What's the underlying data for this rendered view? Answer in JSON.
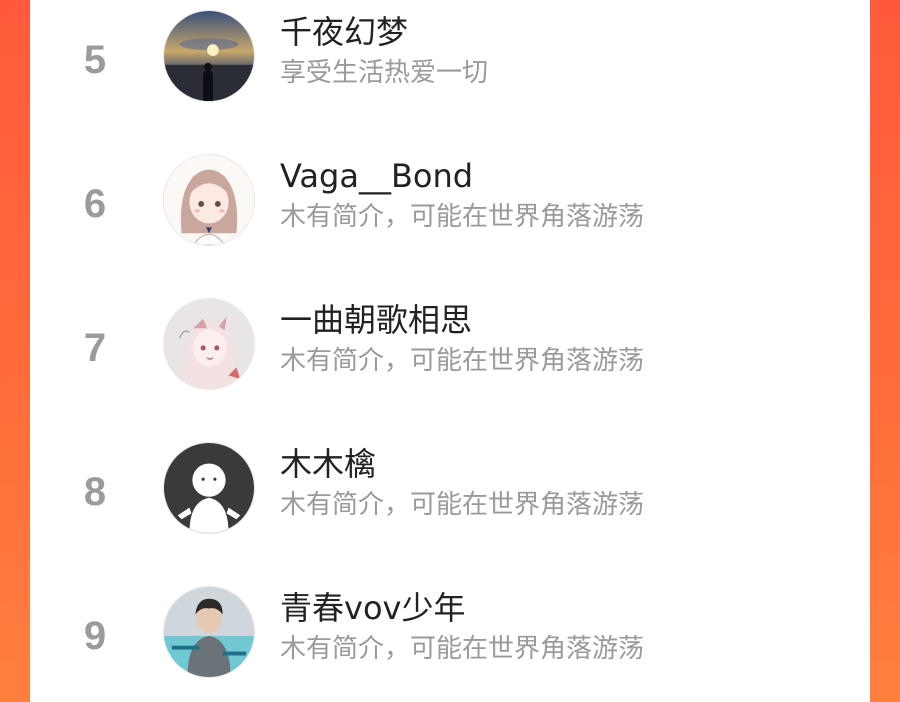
{
  "colors": {
    "background_gradient_top": "#ff5a3c",
    "background_gradient_bottom": "#ff7f3f",
    "card": "#ffffff",
    "rank": "#9b9b9b",
    "name": "#222222",
    "bio": "#9a9a9a"
  },
  "ranking": [
    {
      "rank": "5",
      "name": "千夜幻梦",
      "bio": "享受生活热爱一切",
      "avatar": "sunset-silhouette-avatar"
    },
    {
      "rank": "6",
      "name": "Vaga__Bond",
      "bio": "木有简介，可能在世界角落游荡",
      "avatar": "anime-girl-avatar"
    },
    {
      "rank": "7",
      "name": "一曲朝歌相思",
      "bio": "木有简介，可能在世界角落游荡",
      "avatar": "anime-illustration-avatar"
    },
    {
      "rank": "8",
      "name": "木木檎",
      "bio": "木有简介，可能在世界角落游荡",
      "avatar": "default-user-avatar"
    },
    {
      "rank": "9",
      "name": "青春vov少年",
      "bio": "木有简介，可能在世界角落游荡",
      "avatar": "photo-boy-avatar"
    }
  ]
}
